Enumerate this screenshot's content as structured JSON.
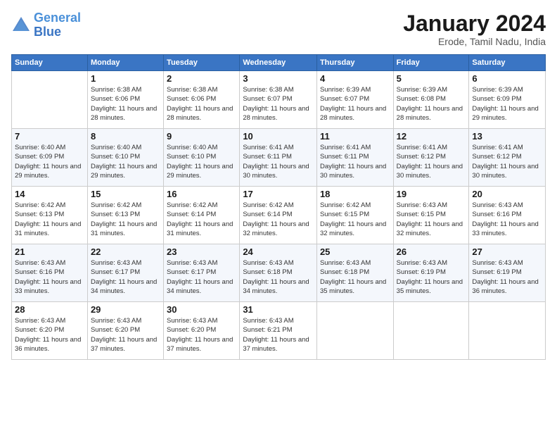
{
  "logo": {
    "line1": "General",
    "line2": "Blue"
  },
  "title": "January 2024",
  "subtitle": "Erode, Tamil Nadu, India",
  "weekdays": [
    "Sunday",
    "Monday",
    "Tuesday",
    "Wednesday",
    "Thursday",
    "Friday",
    "Saturday"
  ],
  "weeks": [
    [
      {
        "day": "",
        "sunrise": "",
        "sunset": "",
        "daylight": ""
      },
      {
        "day": "1",
        "sunrise": "Sunrise: 6:38 AM",
        "sunset": "Sunset: 6:06 PM",
        "daylight": "Daylight: 11 hours and 28 minutes."
      },
      {
        "day": "2",
        "sunrise": "Sunrise: 6:38 AM",
        "sunset": "Sunset: 6:06 PM",
        "daylight": "Daylight: 11 hours and 28 minutes."
      },
      {
        "day": "3",
        "sunrise": "Sunrise: 6:38 AM",
        "sunset": "Sunset: 6:07 PM",
        "daylight": "Daylight: 11 hours and 28 minutes."
      },
      {
        "day": "4",
        "sunrise": "Sunrise: 6:39 AM",
        "sunset": "Sunset: 6:07 PM",
        "daylight": "Daylight: 11 hours and 28 minutes."
      },
      {
        "day": "5",
        "sunrise": "Sunrise: 6:39 AM",
        "sunset": "Sunset: 6:08 PM",
        "daylight": "Daylight: 11 hours and 28 minutes."
      },
      {
        "day": "6",
        "sunrise": "Sunrise: 6:39 AM",
        "sunset": "Sunset: 6:09 PM",
        "daylight": "Daylight: 11 hours and 29 minutes."
      }
    ],
    [
      {
        "day": "7",
        "sunrise": "Sunrise: 6:40 AM",
        "sunset": "Sunset: 6:09 PM",
        "daylight": "Daylight: 11 hours and 29 minutes."
      },
      {
        "day": "8",
        "sunrise": "Sunrise: 6:40 AM",
        "sunset": "Sunset: 6:10 PM",
        "daylight": "Daylight: 11 hours and 29 minutes."
      },
      {
        "day": "9",
        "sunrise": "Sunrise: 6:40 AM",
        "sunset": "Sunset: 6:10 PM",
        "daylight": "Daylight: 11 hours and 29 minutes."
      },
      {
        "day": "10",
        "sunrise": "Sunrise: 6:41 AM",
        "sunset": "Sunset: 6:11 PM",
        "daylight": "Daylight: 11 hours and 30 minutes."
      },
      {
        "day": "11",
        "sunrise": "Sunrise: 6:41 AM",
        "sunset": "Sunset: 6:11 PM",
        "daylight": "Daylight: 11 hours and 30 minutes."
      },
      {
        "day": "12",
        "sunrise": "Sunrise: 6:41 AM",
        "sunset": "Sunset: 6:12 PM",
        "daylight": "Daylight: 11 hours and 30 minutes."
      },
      {
        "day": "13",
        "sunrise": "Sunrise: 6:41 AM",
        "sunset": "Sunset: 6:12 PM",
        "daylight": "Daylight: 11 hours and 30 minutes."
      }
    ],
    [
      {
        "day": "14",
        "sunrise": "Sunrise: 6:42 AM",
        "sunset": "Sunset: 6:13 PM",
        "daylight": "Daylight: 11 hours and 31 minutes."
      },
      {
        "day": "15",
        "sunrise": "Sunrise: 6:42 AM",
        "sunset": "Sunset: 6:13 PM",
        "daylight": "Daylight: 11 hours and 31 minutes."
      },
      {
        "day": "16",
        "sunrise": "Sunrise: 6:42 AM",
        "sunset": "Sunset: 6:14 PM",
        "daylight": "Daylight: 11 hours and 31 minutes."
      },
      {
        "day": "17",
        "sunrise": "Sunrise: 6:42 AM",
        "sunset": "Sunset: 6:14 PM",
        "daylight": "Daylight: 11 hours and 32 minutes."
      },
      {
        "day": "18",
        "sunrise": "Sunrise: 6:42 AM",
        "sunset": "Sunset: 6:15 PM",
        "daylight": "Daylight: 11 hours and 32 minutes."
      },
      {
        "day": "19",
        "sunrise": "Sunrise: 6:43 AM",
        "sunset": "Sunset: 6:15 PM",
        "daylight": "Daylight: 11 hours and 32 minutes."
      },
      {
        "day": "20",
        "sunrise": "Sunrise: 6:43 AM",
        "sunset": "Sunset: 6:16 PM",
        "daylight": "Daylight: 11 hours and 33 minutes."
      }
    ],
    [
      {
        "day": "21",
        "sunrise": "Sunrise: 6:43 AM",
        "sunset": "Sunset: 6:16 PM",
        "daylight": "Daylight: 11 hours and 33 minutes."
      },
      {
        "day": "22",
        "sunrise": "Sunrise: 6:43 AM",
        "sunset": "Sunset: 6:17 PM",
        "daylight": "Daylight: 11 hours and 34 minutes."
      },
      {
        "day": "23",
        "sunrise": "Sunrise: 6:43 AM",
        "sunset": "Sunset: 6:17 PM",
        "daylight": "Daylight: 11 hours and 34 minutes."
      },
      {
        "day": "24",
        "sunrise": "Sunrise: 6:43 AM",
        "sunset": "Sunset: 6:18 PM",
        "daylight": "Daylight: 11 hours and 34 minutes."
      },
      {
        "day": "25",
        "sunrise": "Sunrise: 6:43 AM",
        "sunset": "Sunset: 6:18 PM",
        "daylight": "Daylight: 11 hours and 35 minutes."
      },
      {
        "day": "26",
        "sunrise": "Sunrise: 6:43 AM",
        "sunset": "Sunset: 6:19 PM",
        "daylight": "Daylight: 11 hours and 35 minutes."
      },
      {
        "day": "27",
        "sunrise": "Sunrise: 6:43 AM",
        "sunset": "Sunset: 6:19 PM",
        "daylight": "Daylight: 11 hours and 36 minutes."
      }
    ],
    [
      {
        "day": "28",
        "sunrise": "Sunrise: 6:43 AM",
        "sunset": "Sunset: 6:20 PM",
        "daylight": "Daylight: 11 hours and 36 minutes."
      },
      {
        "day": "29",
        "sunrise": "Sunrise: 6:43 AM",
        "sunset": "Sunset: 6:20 PM",
        "daylight": "Daylight: 11 hours and 37 minutes."
      },
      {
        "day": "30",
        "sunrise": "Sunrise: 6:43 AM",
        "sunset": "Sunset: 6:20 PM",
        "daylight": "Daylight: 11 hours and 37 minutes."
      },
      {
        "day": "31",
        "sunrise": "Sunrise: 6:43 AM",
        "sunset": "Sunset: 6:21 PM",
        "daylight": "Daylight: 11 hours and 37 minutes."
      },
      {
        "day": "",
        "sunrise": "",
        "sunset": "",
        "daylight": ""
      },
      {
        "day": "",
        "sunrise": "",
        "sunset": "",
        "daylight": ""
      },
      {
        "day": "",
        "sunrise": "",
        "sunset": "",
        "daylight": ""
      }
    ]
  ]
}
